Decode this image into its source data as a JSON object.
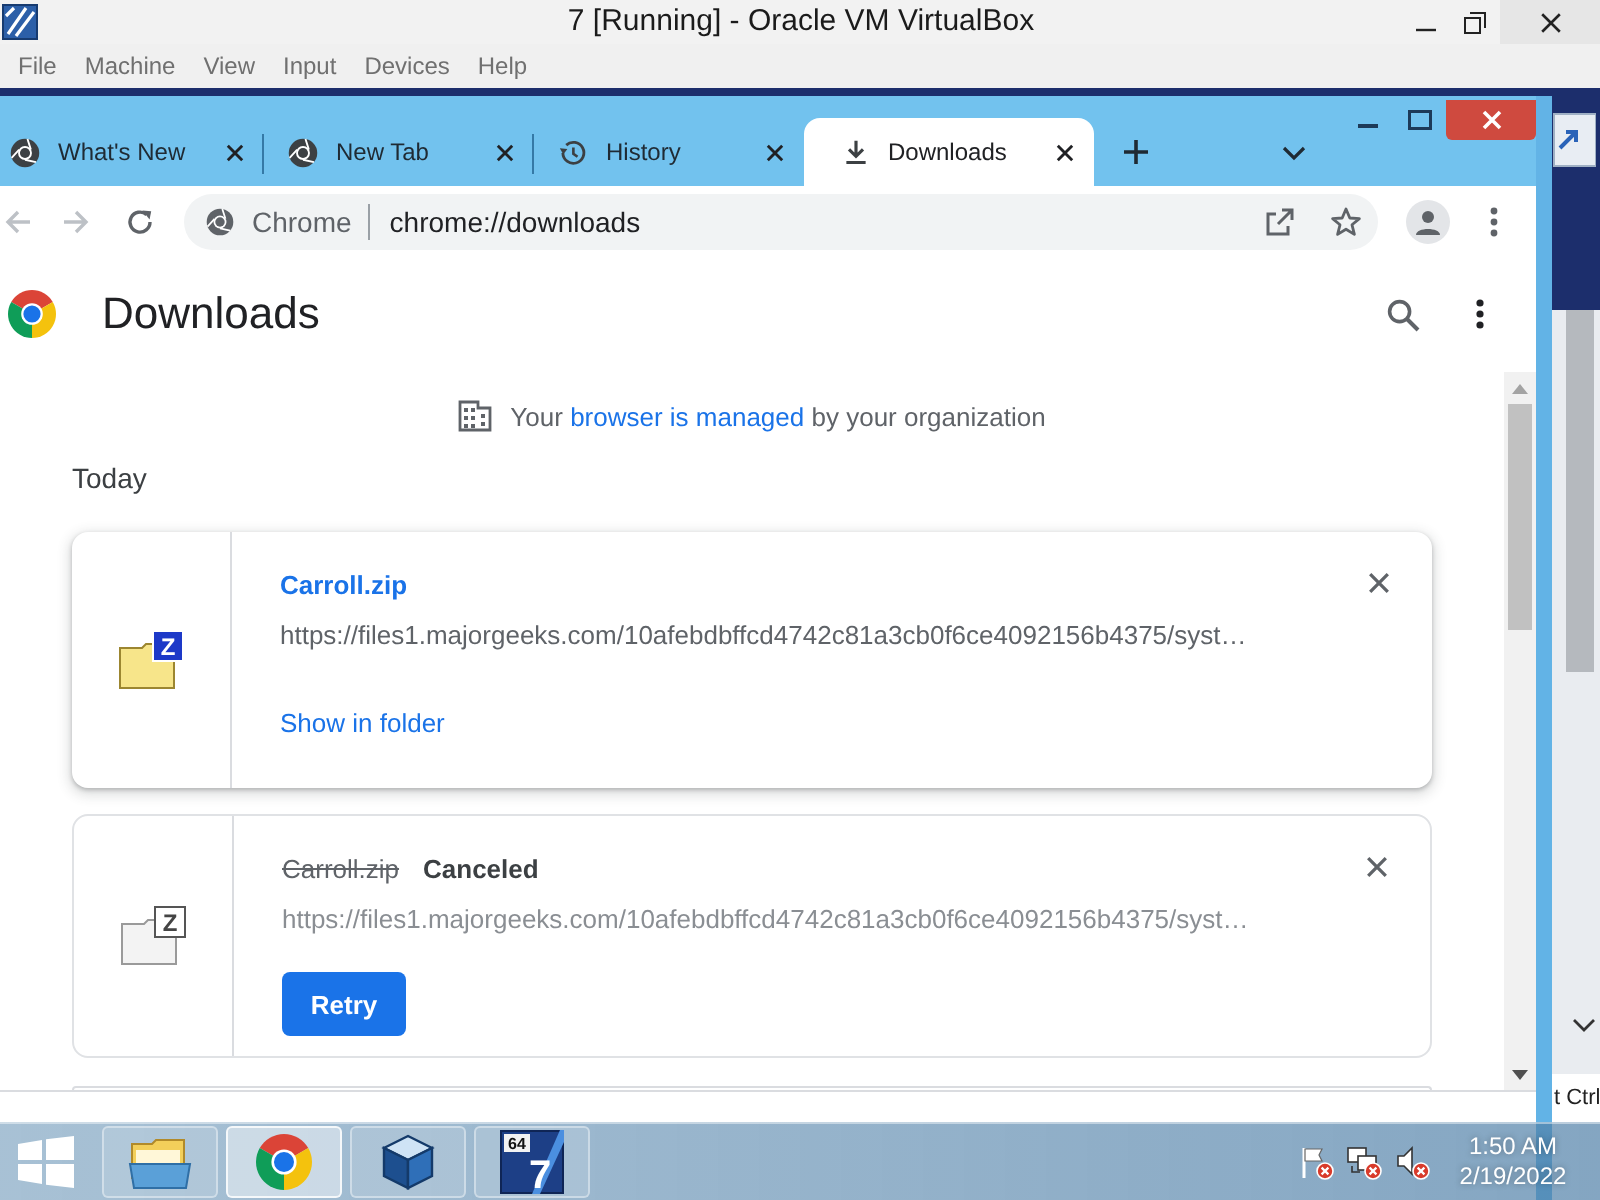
{
  "host_window": {
    "title": "7 [Running] - Oracle VM VirtualBox",
    "menu": [
      "File",
      "Machine",
      "View",
      "Input",
      "Devices",
      "Help"
    ]
  },
  "browser": {
    "tabs": [
      {
        "kind": "web",
        "label": "What's New",
        "selected": false
      },
      {
        "kind": "web",
        "label": "New Tab",
        "selected": false
      },
      {
        "kind": "history",
        "label": "History",
        "selected": false
      },
      {
        "kind": "downloads",
        "label": "Downloads",
        "selected": true
      }
    ],
    "nav": [
      {
        "kind": "back",
        "disabled": true
      },
      {
        "kind": "forward",
        "disabled": true
      },
      {
        "kind": "reload",
        "disabled": false
      }
    ],
    "omnibox": {
      "chip": "Chrome",
      "value": "chrome://downloads"
    }
  },
  "page": {
    "title": "Downloads",
    "notice": {
      "before": "Your",
      "link": "browser is managed",
      "after": "by your organization"
    },
    "section": "Today",
    "downloads": [
      {
        "kind": "complete",
        "icon_letter": "Z",
        "name": "Carroll.zip",
        "url": "https://files1.majorgeeks.com/10afebdbffcd4742c81a3cb0f6ce4092156b4375/syst…",
        "action": "Show in folder"
      },
      {
        "kind": "canceled",
        "icon_letter": "Z",
        "name": "Carroll.zip",
        "status": "Canceled",
        "url": "https://files1.majorgeeks.com/10afebdbffcd4742c81a3cb0f6ce4092156b4375/syst…",
        "action": "Retry"
      },
      {
        "kind": "partial"
      }
    ]
  },
  "taskbar": {
    "apps": [
      {
        "kind": "explorer",
        "selected": false
      },
      {
        "kind": "browser",
        "selected": true
      },
      {
        "kind": "virtualbox",
        "selected": false
      },
      {
        "kind": "vm",
        "badge": "64",
        "label": "7",
        "selected": false
      }
    ],
    "time": "1:50 AM",
    "date": "2/19/2022"
  },
  "host_status": {
    "key": "t Ctrl"
  }
}
